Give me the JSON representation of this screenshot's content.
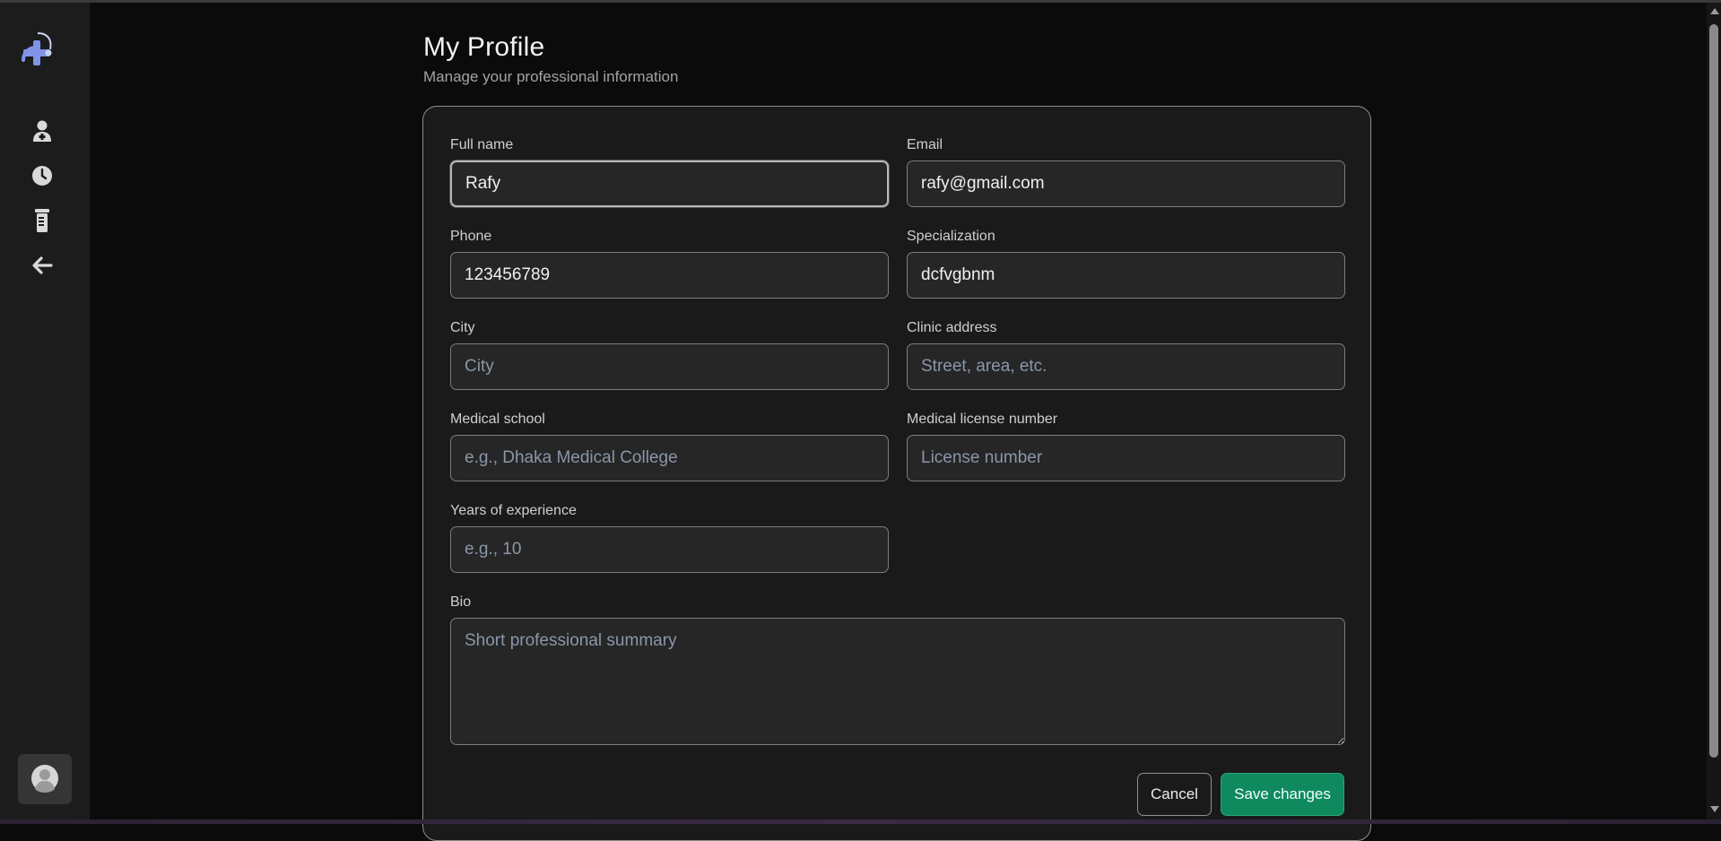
{
  "header": {
    "title": "My Profile",
    "subtitle": "Manage your professional information"
  },
  "sidebar": {
    "items": [
      {
        "icon": "doctor-icon",
        "label": ""
      },
      {
        "icon": "clock-icon",
        "label": ""
      },
      {
        "icon": "document-icon",
        "label": ""
      },
      {
        "icon": "arrow-left-icon",
        "label": ""
      }
    ],
    "avatar_icon": "user-avatar-icon",
    "logo_icon": "medical-logo-icon"
  },
  "form": {
    "full_name": {
      "label": "Full name",
      "value": "Rafy",
      "placeholder": ""
    },
    "email": {
      "label": "Email",
      "value": "rafy@gmail.com",
      "placeholder": ""
    },
    "phone": {
      "label": "Phone",
      "value": "123456789",
      "placeholder": ""
    },
    "specialization": {
      "label": "Specialization",
      "value": "dcfvgbnm",
      "placeholder": ""
    },
    "city": {
      "label": "City",
      "value": "",
      "placeholder": "City"
    },
    "clinic_address": {
      "label": "Clinic address",
      "value": "",
      "placeholder": "Street, area, etc."
    },
    "medical_school": {
      "label": "Medical school",
      "value": "",
      "placeholder": "e.g., Dhaka Medical College"
    },
    "license_number": {
      "label": "Medical license number",
      "value": "",
      "placeholder": "License number"
    },
    "years_experience": {
      "label": "Years of experience",
      "value": "",
      "placeholder": "e.g., 10"
    },
    "bio": {
      "label": "Bio",
      "value": "",
      "placeholder": "Short professional summary"
    }
  },
  "actions": {
    "cancel_label": "Cancel",
    "save_label": "Save changes"
  },
  "colors": {
    "accent_save": "#0f8a5f",
    "logo_blue": "#7f93e8",
    "background": "#0b0b0b",
    "sidebar": "#1c1c1c",
    "card": "#1a1a1a"
  }
}
